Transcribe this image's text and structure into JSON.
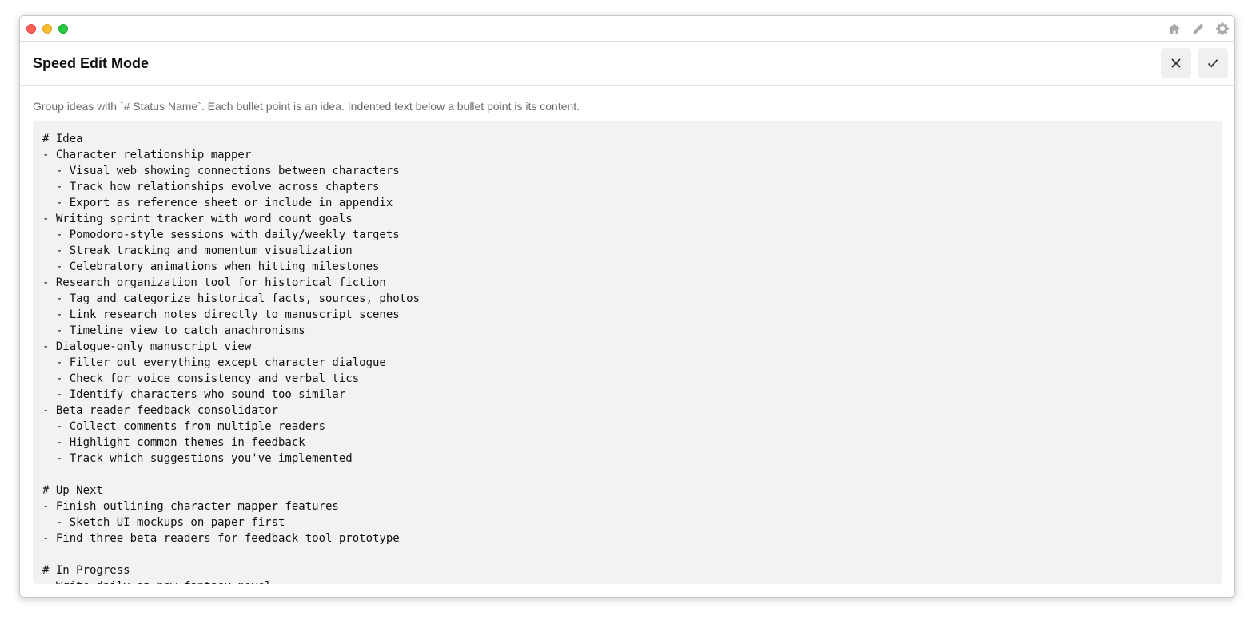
{
  "window": {
    "tools": [
      "home-icon",
      "pencil-icon",
      "gear-icon"
    ]
  },
  "header": {
    "title": "Speed Edit Mode",
    "cancel_icon": "close-icon",
    "confirm_icon": "check-icon"
  },
  "help_text": "Group ideas with `# Status Name`. Each bullet point is an idea. Indented text below a bullet point is its content.",
  "editor": {
    "value": "# Idea\n- Character relationship mapper\n  - Visual web showing connections between characters\n  - Track how relationships evolve across chapters\n  - Export as reference sheet or include in appendix\n- Writing sprint tracker with word count goals\n  - Pomodoro-style sessions with daily/weekly targets\n  - Streak tracking and momentum visualization\n  - Celebratory animations when hitting milestones\n- Research organization tool for historical fiction\n  - Tag and categorize historical facts, sources, photos\n  - Link research notes directly to manuscript scenes\n  - Timeline view to catch anachronisms\n- Dialogue-only manuscript view\n  - Filter out everything except character dialogue\n  - Check for voice consistency and verbal tics\n  - Identify characters who sound too similar\n- Beta reader feedback consolidator\n  - Collect comments from multiple readers\n  - Highlight common themes in feedback\n  - Track which suggestions you've implemented\n\n# Up Next\n- Finish outlining character mapper features\n  - Sketch UI mockups on paper first\n- Find three beta readers for feedback tool prototype\n\n# In Progress\n- Write daily on new fantasy novel"
  },
  "colors": {
    "close": "#fe5f57",
    "minimize": "#febc2e",
    "zoom": "#28c840",
    "editor_bg": "#f2f2f2",
    "help_text": "#6b6b6b"
  }
}
